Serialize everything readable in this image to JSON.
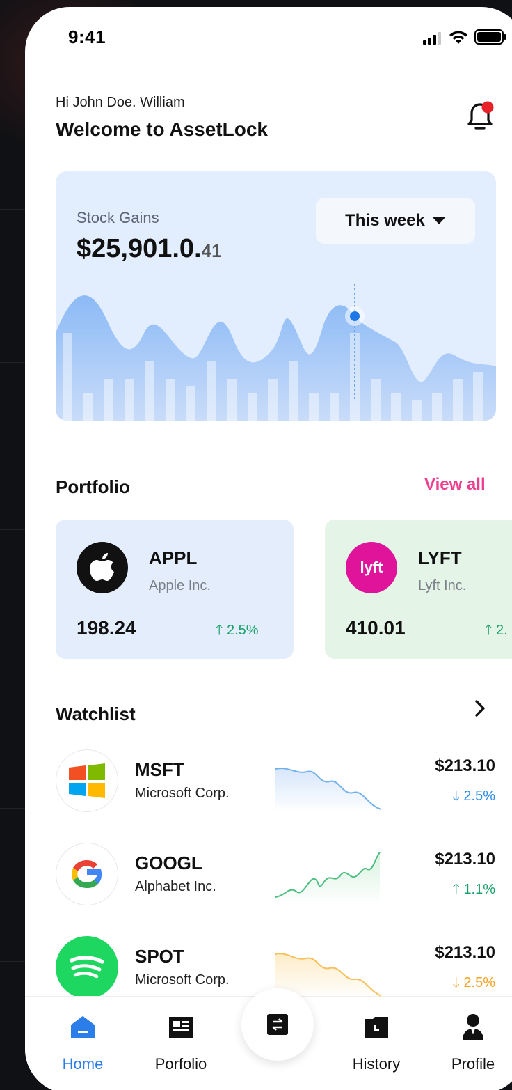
{
  "status_bar": {
    "time": "9:41"
  },
  "header": {
    "greeting": "Hi John Doe. William",
    "welcome": "Welcome to AssetLock",
    "notification_icon": "bell-icon"
  },
  "gains": {
    "label": "Stock Gains",
    "value_main": "$25,901.0.",
    "value_cents": "41",
    "period_label": "This week",
    "accent": "#2b7de9"
  },
  "portfolio": {
    "title": "Portfolio",
    "view_all": "View all",
    "cards": [
      {
        "symbol": "APPL",
        "name": "Apple Inc.",
        "price": "198.24",
        "change": "2.5%",
        "direction": "up",
        "bg": "#e3edfc",
        "logo": "apple-logo"
      },
      {
        "symbol": "LYFT",
        "name": "Lyft Inc.",
        "price": "410.01",
        "change": "2.",
        "direction": "up",
        "bg": "#e4f4e6",
        "logo": "lyft-logo"
      }
    ]
  },
  "watchlist": {
    "title": "Watchlist",
    "items": [
      {
        "symbol": "MSFT",
        "name": "Microsoft Corp.",
        "price": "$213.10",
        "change": "2.5%",
        "direction": "down",
        "color": "#2d8ceb",
        "logo": "microsoft-logo"
      },
      {
        "symbol": "GOOGL",
        "name": "Alphabet Inc.",
        "price": "$213.10",
        "change": "1.1%",
        "direction": "up",
        "color": "#1aa16a",
        "logo": "google-logo"
      },
      {
        "symbol": "SPOT",
        "name": "Microsoft Corp.",
        "price": "$213.10",
        "change": "2.5%",
        "direction": "down",
        "color": "#f5a020",
        "logo": "spotify-logo"
      }
    ]
  },
  "nav": {
    "items": [
      {
        "label": "Home",
        "icon": "home-icon",
        "active": true
      },
      {
        "label": "Porfolio",
        "icon": "portfolio-icon",
        "active": false
      },
      {
        "label": "",
        "icon": "swap-icon",
        "active": false
      },
      {
        "label": "History",
        "icon": "history-icon",
        "active": false
      },
      {
        "label": "Profile",
        "icon": "profile-icon",
        "active": false
      }
    ]
  }
}
